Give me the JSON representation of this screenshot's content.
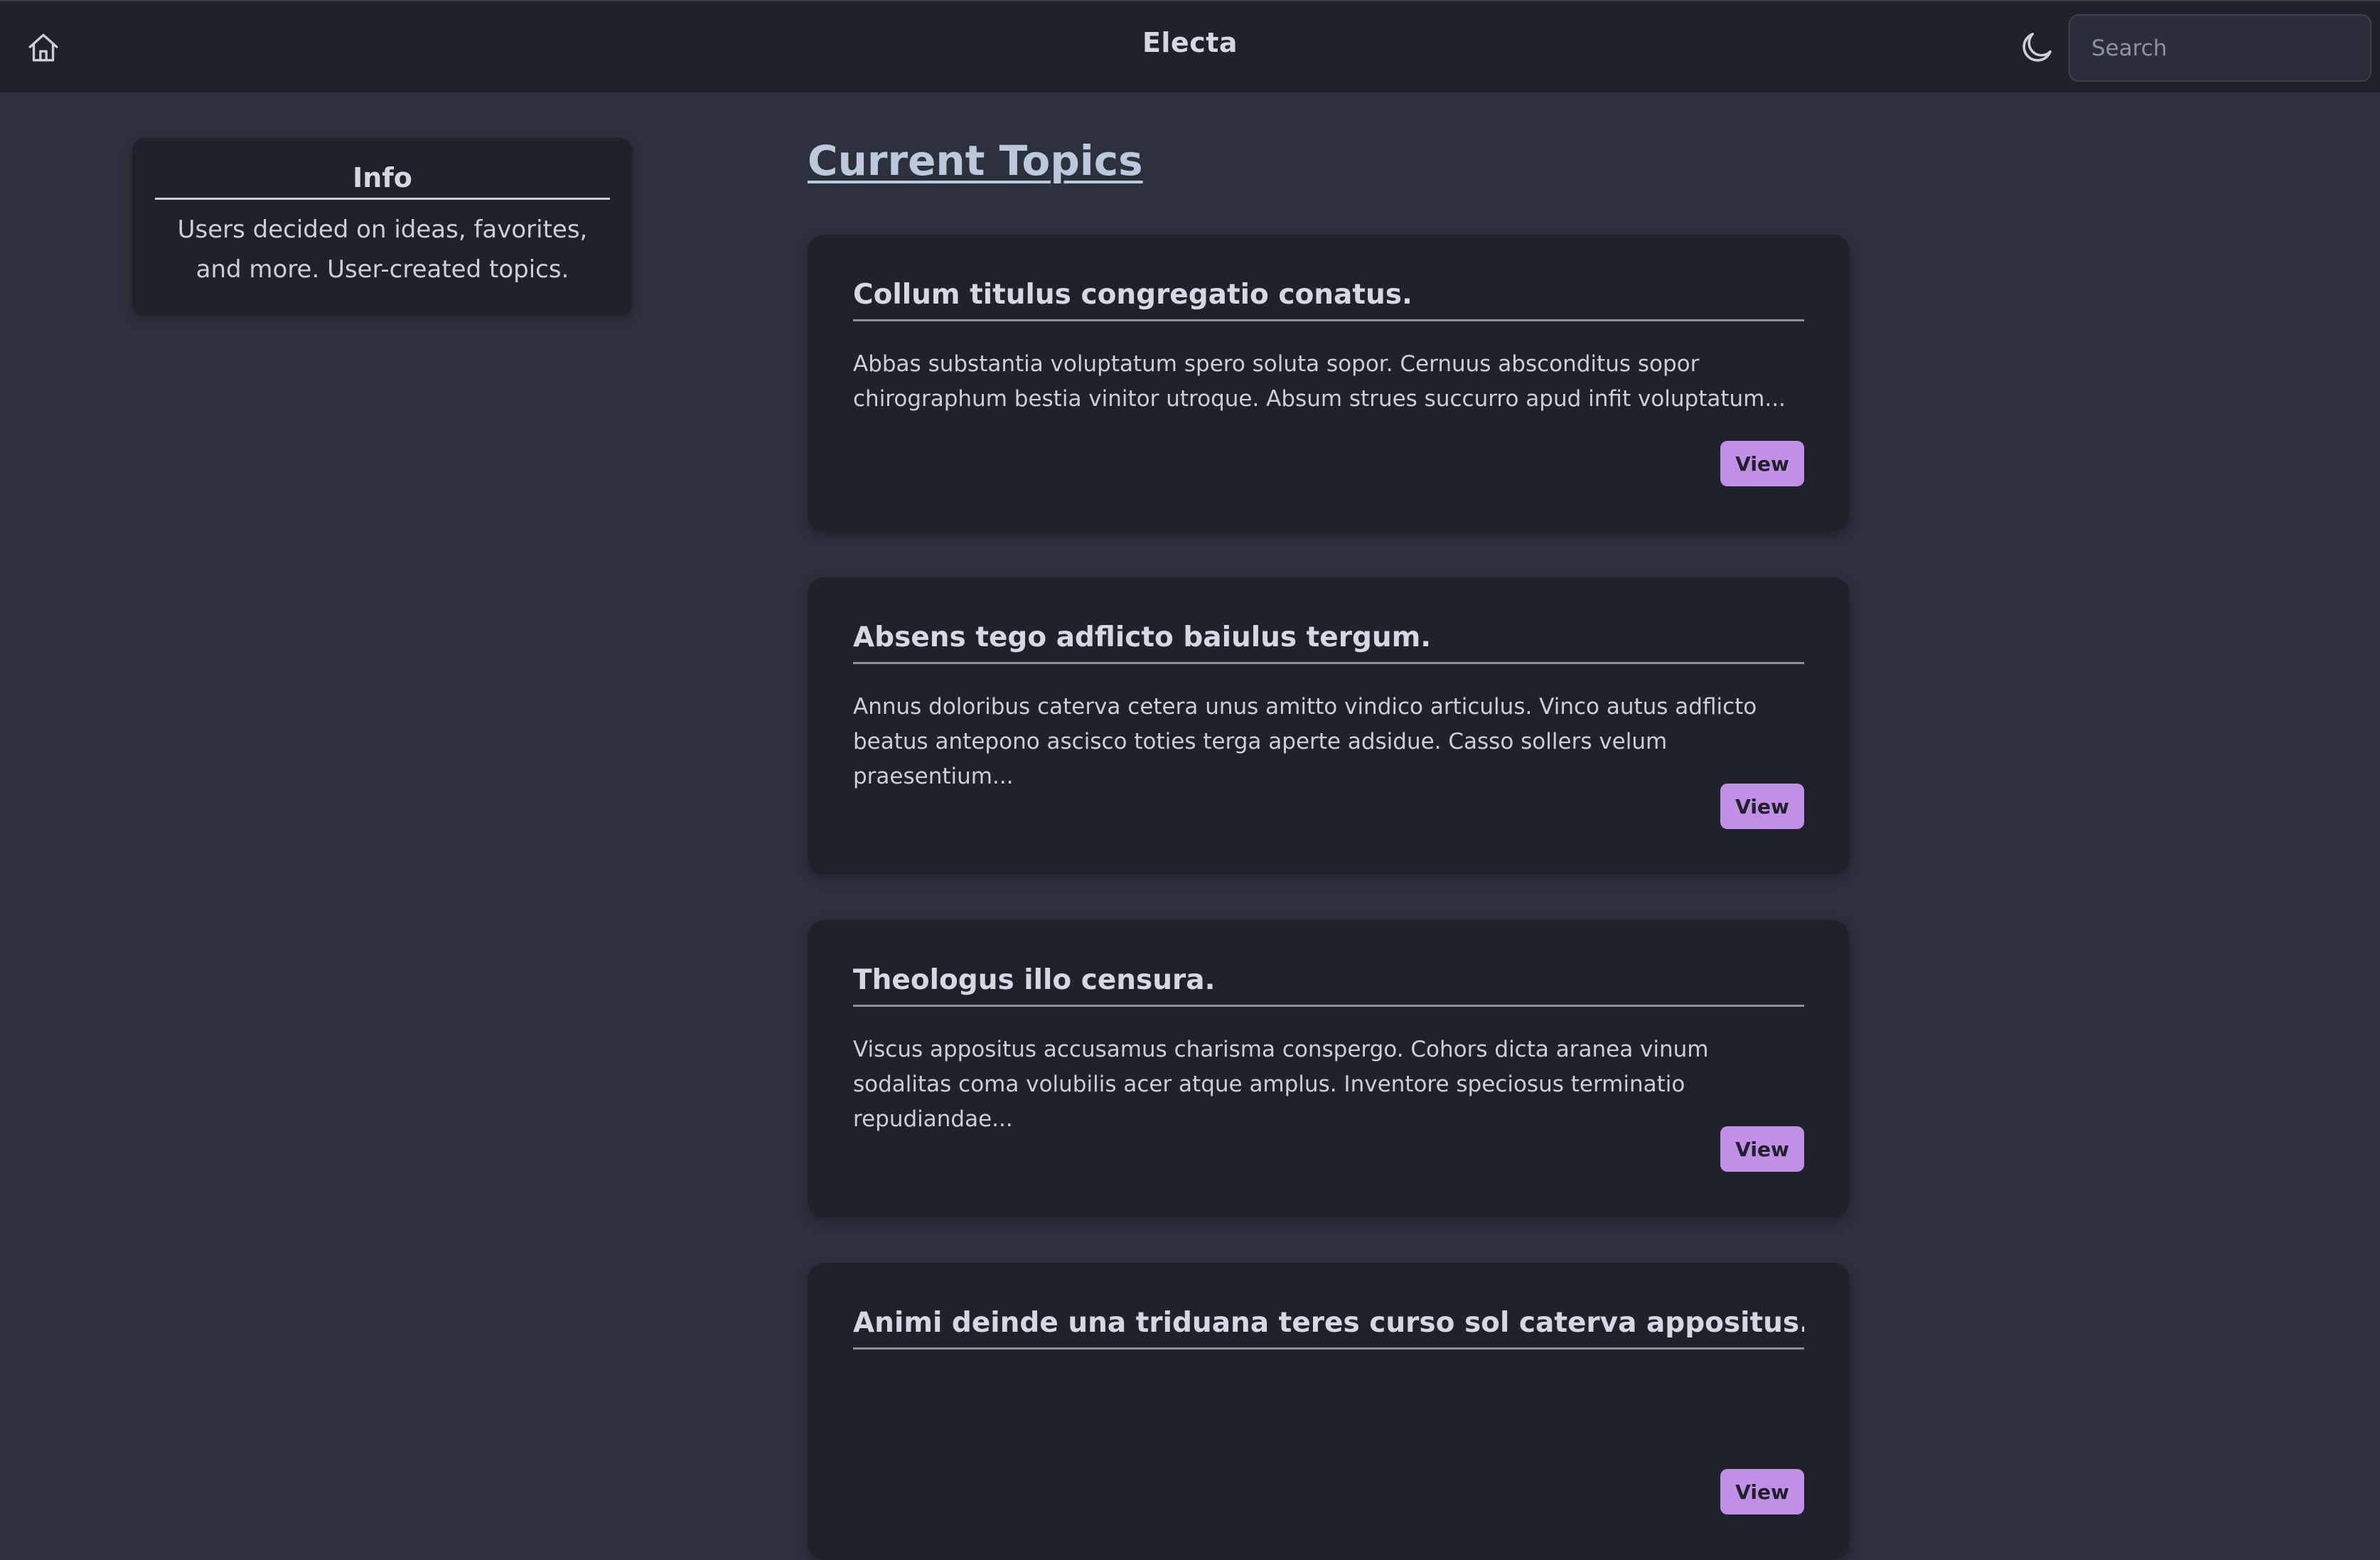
{
  "navbar": {
    "home_icon": "home-icon",
    "title": "Electa",
    "theme_icon": "moon-icon",
    "search_placeholder": "Search"
  },
  "info": {
    "title": "Info",
    "text": "Users decided on ideas, favorites, and more. User-created topics."
  },
  "main": {
    "section_title": "Current Topics",
    "topics": [
      {
        "title": "Collum titulus congregatio conatus.",
        "description": "Abbas substantia voluptatum spero soluta sopor. Cernuus absconditus sopor chirographum bestia vinitor utroque. Absum strues succurro apud infit voluptatum...",
        "button": "View"
      },
      {
        "title": "Absens tego adflicto baiulus tergum.",
        "description": "Annus doloribus caterva cetera unus amitto vindico articulus. Vinco autus adflicto beatus antepono ascisco toties terga aperte adsidue. Casso sollers velum praesentium...",
        "button": "View"
      },
      {
        "title": "Theologus illo censura.",
        "description": "Viscus appositus accusamus charisma conspergo. Cohors dicta aranea vinum sodalitas coma volubilis acer atque amplus. Inventore speciosus terminatio repudiandae...",
        "button": "View"
      },
      {
        "title": "Animi deinde una triduana teres curso sol caterva appositus.",
        "description": "",
        "button": "View"
      }
    ]
  },
  "colors": {
    "page_background": "#2d313e",
    "card_background": "#1f222b",
    "accent": "#c18fe6",
    "text": "#c9cfdb"
  }
}
